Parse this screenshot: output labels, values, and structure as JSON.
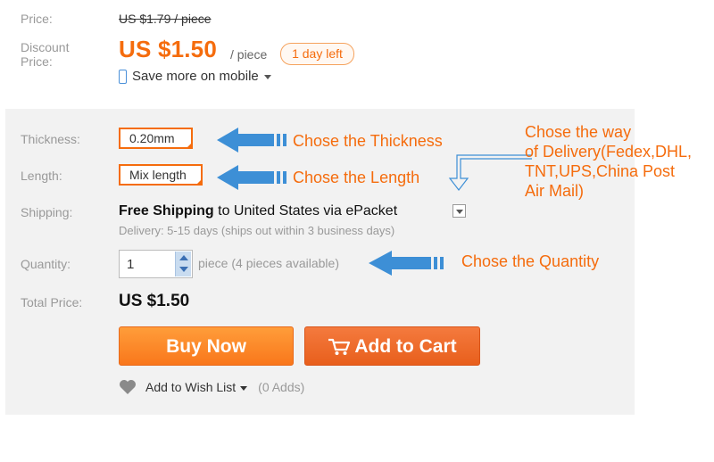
{
  "price": {
    "label": "Price:",
    "original": "US $1.79 / piece"
  },
  "discount": {
    "label_line1": "Discount",
    "label_line2": "Price:",
    "value": "US $1.50",
    "unit": "/ piece",
    "badge": "1 day left"
  },
  "mobile": {
    "text": "Save more on mobile"
  },
  "thickness": {
    "label": "Thickness:",
    "value": "0.20mm"
  },
  "length": {
    "label": "Length:",
    "value": "Mix length"
  },
  "shipping": {
    "label": "Shipping:",
    "method": "Free Shipping",
    "to_text": "to",
    "destination": "United States via ePacket",
    "delivery": "Delivery: 5-15 days (ships out within 3 business days)"
  },
  "quantity": {
    "label": "Quantity:",
    "value": "1",
    "info": "piece (4 pieces available)"
  },
  "total": {
    "label": "Total Price:",
    "value": "US $1.50"
  },
  "actions": {
    "buy_now": "Buy Now",
    "add_to_cart": "Add to Cart"
  },
  "wishlist": {
    "label": "Add to Wish List",
    "adds": "(0 Adds)"
  },
  "annotations": {
    "thickness": "Chose the Thickness",
    "length": "Chose the Length",
    "quantity": "Chose the Quantity",
    "delivery_line1": "Chose the way",
    "delivery_line2": "of Delivery(Fedex,DHL,",
    "delivery_line3": "TNT,UPS,China Post",
    "delivery_line4": "Air Mail)"
  },
  "colors": {
    "accent": "#f56c0d",
    "arrow": "#3d8fd6",
    "panel": "#f2f2f2"
  },
  "icons": [
    "phone-icon",
    "chevron-down-icon",
    "arrow-left-icon",
    "arrow-down-icon",
    "cart-icon",
    "heart-icon",
    "stepper-icon"
  ]
}
